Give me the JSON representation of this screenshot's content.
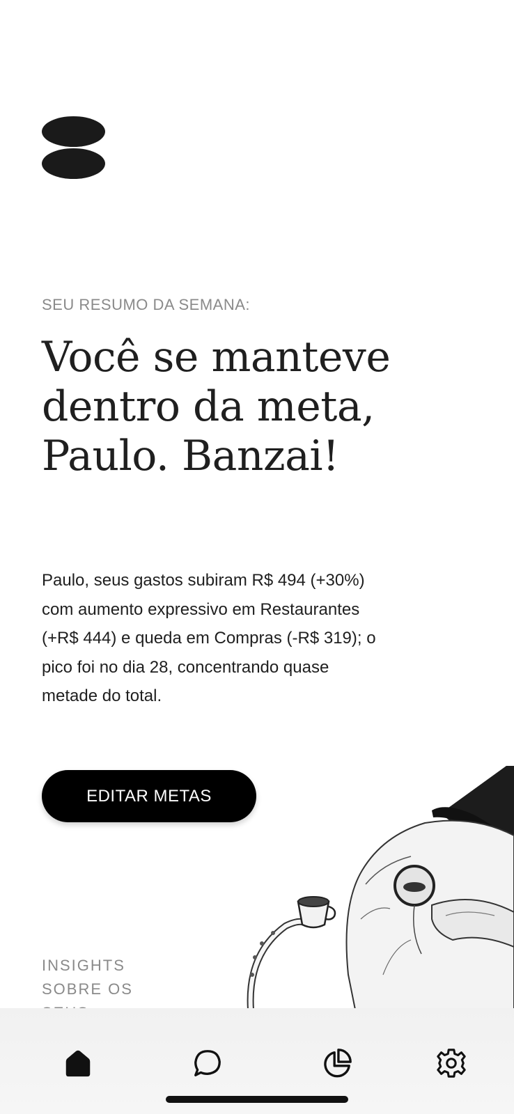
{
  "brand": {
    "logo_icon": "stacked-pills-logo"
  },
  "summary_section": {
    "eyebrow": "SEU RESUMO DA SEMANA:",
    "headline": "Você se manteve dentro da meta, Paulo. Banzai!",
    "body": "Paulo, seus gastos subiram R$ 494 (+30%) com aumento expressivo em Restaurantes (+R$ 444) e queda em Compras (-R$ 319); o pico foi no dia 28, concentrando quase metade do total.",
    "edit_button_label": "EDITAR METAS"
  },
  "insights_section": {
    "title": "INSIGHTS SOBRE OS SEUS"
  },
  "illustration": {
    "icon": "octopus-top-hat-monocle-teacup-illustration"
  },
  "tabbar": {
    "items": [
      {
        "icon": "home-icon",
        "active": true
      },
      {
        "icon": "chat-bubble-icon",
        "active": false
      },
      {
        "icon": "pie-chart-icon",
        "active": false
      },
      {
        "icon": "gear-icon",
        "active": false
      }
    ]
  },
  "colors": {
    "text": "#1f1f1f",
    "muted": "#8a8a8a",
    "button_bg": "#000000",
    "button_text": "#ffffff"
  }
}
